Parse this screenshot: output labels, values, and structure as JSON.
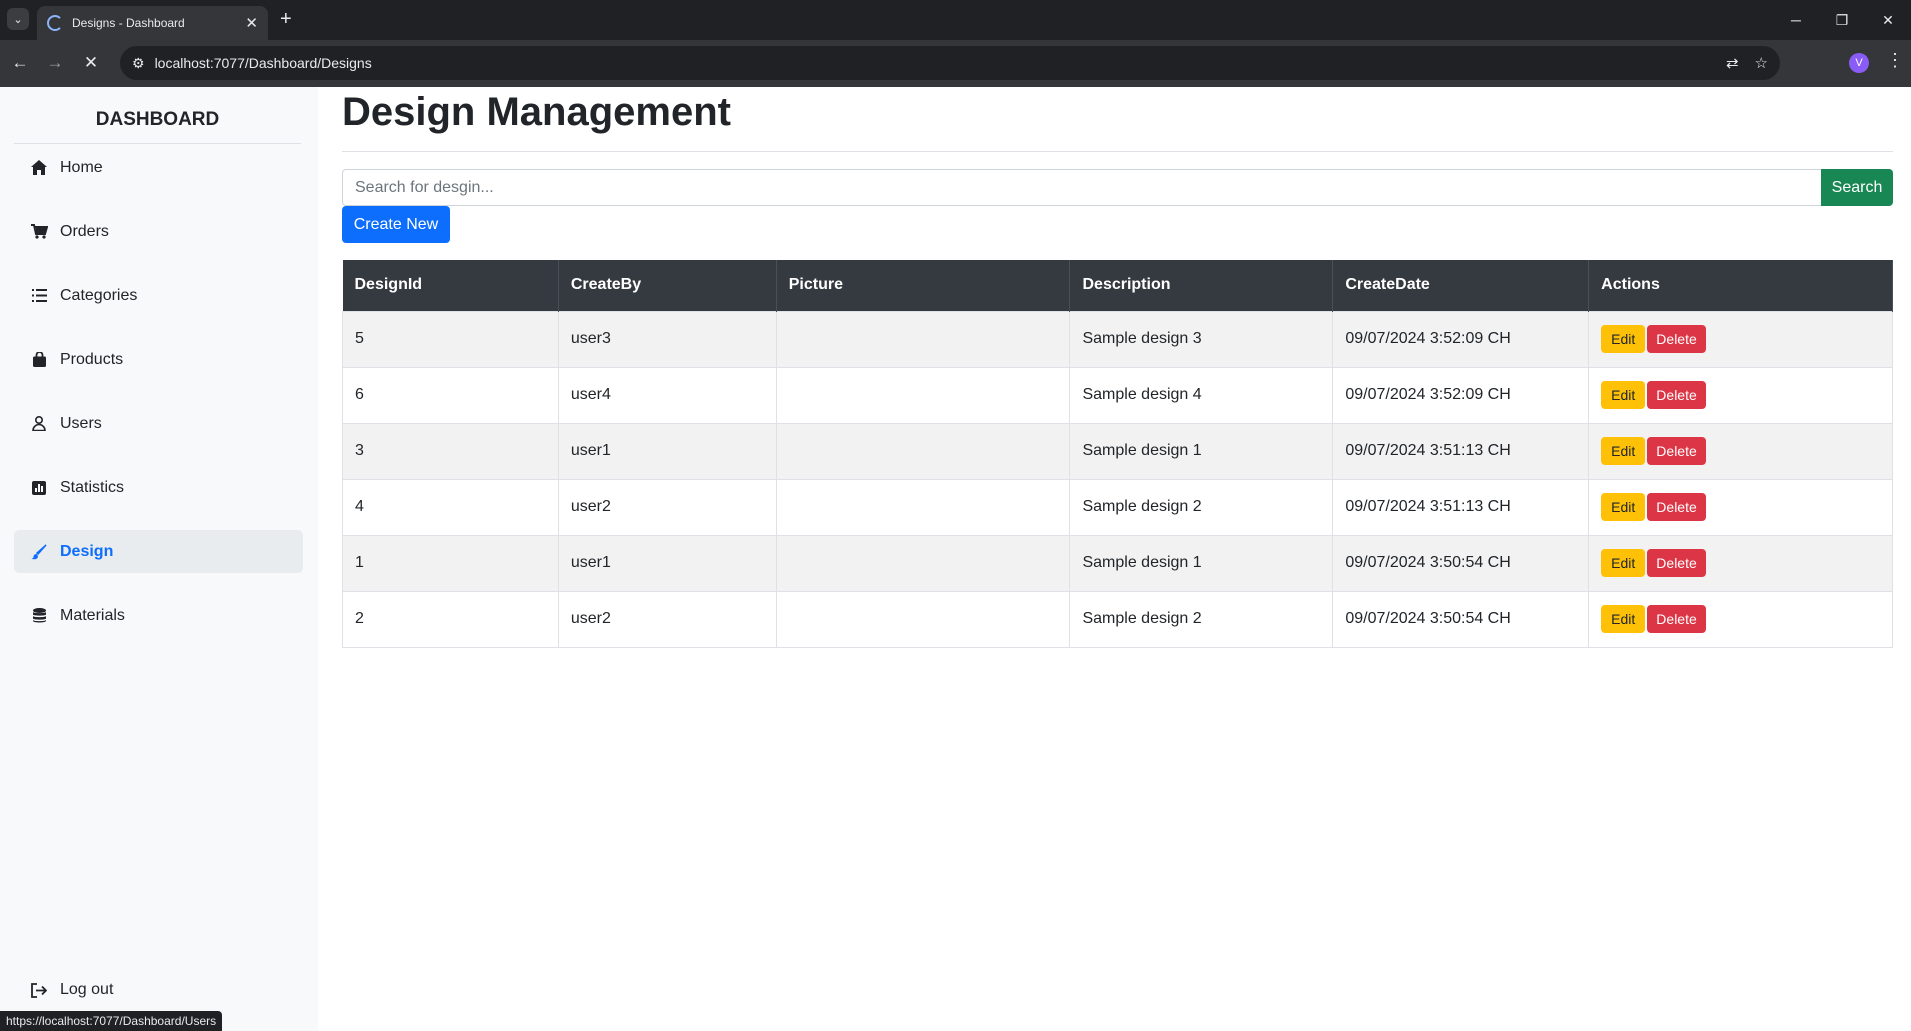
{
  "browser": {
    "tab_title": "Designs - Dashboard",
    "url": "localhost:7077/Dashboard/Designs",
    "profile_initial": "V",
    "status_url": "https://localhost:7077/Dashboard/Users"
  },
  "sidebar": {
    "brand": "DASHBOARD",
    "items": [
      {
        "label": "Home",
        "icon": "home-icon"
      },
      {
        "label": "Orders",
        "icon": "cart-icon"
      },
      {
        "label": "Categories",
        "icon": "list-icon"
      },
      {
        "label": "Products",
        "icon": "bag-icon"
      },
      {
        "label": "Users",
        "icon": "user-icon"
      },
      {
        "label": "Statistics",
        "icon": "chart-icon"
      },
      {
        "label": "Design",
        "icon": "brush-icon",
        "active": true
      },
      {
        "label": "Materials",
        "icon": "database-icon"
      }
    ],
    "logout": "Log out"
  },
  "main": {
    "title": "Design Management",
    "search_placeholder": "Search for desgin...",
    "search_button": "Search",
    "create_button": "Create New",
    "table": {
      "headers": [
        "DesignId",
        "CreateBy",
        "Picture",
        "Description",
        "CreateDate",
        "Actions"
      ],
      "rows": [
        {
          "id": "5",
          "created_by": "user3",
          "picture": "",
          "description": "Sample design 3",
          "create_date": "09/07/2024 3:52:09 CH"
        },
        {
          "id": "6",
          "created_by": "user4",
          "picture": "",
          "description": "Sample design 4",
          "create_date": "09/07/2024 3:52:09 CH"
        },
        {
          "id": "3",
          "created_by": "user1",
          "picture": "",
          "description": "Sample design 1",
          "create_date": "09/07/2024 3:51:13 CH"
        },
        {
          "id": "4",
          "created_by": "user2",
          "picture": "",
          "description": "Sample design 2",
          "create_date": "09/07/2024 3:51:13 CH"
        },
        {
          "id": "1",
          "created_by": "user1",
          "picture": "",
          "description": "Sample design 1",
          "create_date": "09/07/2024 3:50:54 CH"
        },
        {
          "id": "2",
          "created_by": "user2",
          "picture": "",
          "description": "Sample design 2",
          "create_date": "09/07/2024 3:50:54 CH"
        }
      ],
      "edit_label": "Edit",
      "delete_label": "Delete"
    }
  },
  "colors": {
    "primary": "#0d6efd",
    "success": "#198754",
    "warning": "#ffc107",
    "danger": "#dc3545",
    "table_header": "#343a40"
  }
}
